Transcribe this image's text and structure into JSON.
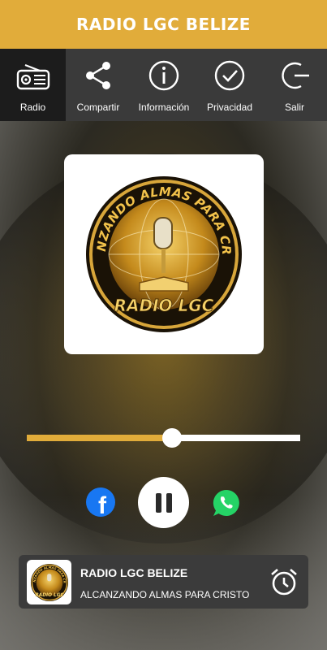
{
  "header": {
    "title": "RADIO LGC BELIZE"
  },
  "nav": {
    "items": [
      {
        "label": "Radio",
        "icon": "radio-icon",
        "active": true
      },
      {
        "label": "Compartir",
        "icon": "share-icon",
        "active": false
      },
      {
        "label": "Información",
        "icon": "info-icon",
        "active": false
      },
      {
        "label": "Privacidad",
        "icon": "check-circle-icon",
        "active": false
      },
      {
        "label": "Salir",
        "icon": "exit-icon",
        "active": false
      }
    ]
  },
  "artwork": {
    "arc_text": "ALCANZANDO ALMAS PARA CRISTO",
    "logo_text": "RADIO LGC"
  },
  "player": {
    "volume": 0.53,
    "state": "playing"
  },
  "mini_player": {
    "title": "RADIO LGC BELIZE",
    "subtitle": "ALCANZANDO ALMAS PARA CRISTO",
    "thumb_arc_text": "ALCANZANDO ALMAS PARA CRISTO",
    "thumb_logo_text": "RADIO LGC"
  },
  "colors": {
    "accent": "#e1ac3a",
    "nav_bg": "#3a3a3a",
    "nav_active_bg": "#1c1c1c",
    "facebook": "#1877f2",
    "whatsapp": "#25d366"
  }
}
